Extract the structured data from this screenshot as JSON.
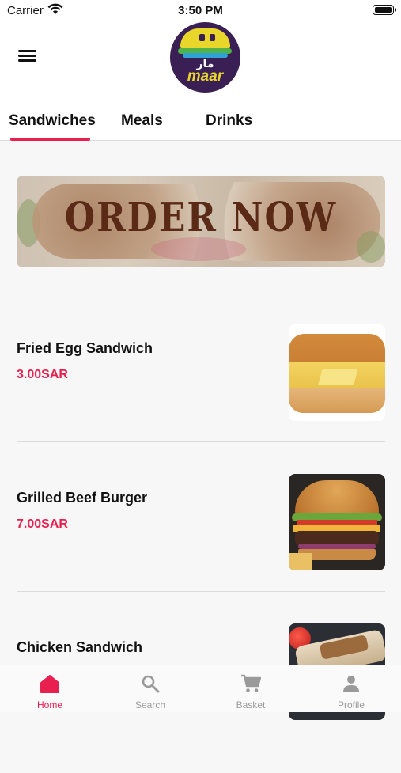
{
  "status_bar": {
    "carrier": "Carrier",
    "time": "3:50 PM"
  },
  "header": {
    "menu_icon": "hamburger-menu-icon",
    "logo": {
      "arabic_text": "مار",
      "word": "maar"
    }
  },
  "tabs": [
    {
      "label": "Sandwiches",
      "active": true
    },
    {
      "label": "Meals",
      "active": false
    },
    {
      "label": "Drinks",
      "active": false
    }
  ],
  "banner": {
    "text": "ORDER NOW"
  },
  "products": [
    {
      "name": "Fried Egg Sandwich",
      "price": "3.00SAR",
      "image": "fried-egg-sandwich"
    },
    {
      "name": "Grilled Beef Burger",
      "price": "7.00SAR",
      "image": "grilled-beef-burger"
    },
    {
      "name": "Chicken Sandwich",
      "price": "",
      "image": "chicken-sandwich"
    }
  ],
  "tab_bar": [
    {
      "label": "Home",
      "icon": "home-icon",
      "active": true
    },
    {
      "label": "Search",
      "icon": "search-icon",
      "active": false
    },
    {
      "label": "Basket",
      "icon": "cart-icon",
      "active": false
    },
    {
      "label": "Profile",
      "icon": "person-icon",
      "active": false
    }
  ],
  "colors": {
    "accent": "#e8204f",
    "inactive": "#9a9a9a",
    "logo_bg": "#3a1f55",
    "logo_yellow": "#e9d62a"
  }
}
